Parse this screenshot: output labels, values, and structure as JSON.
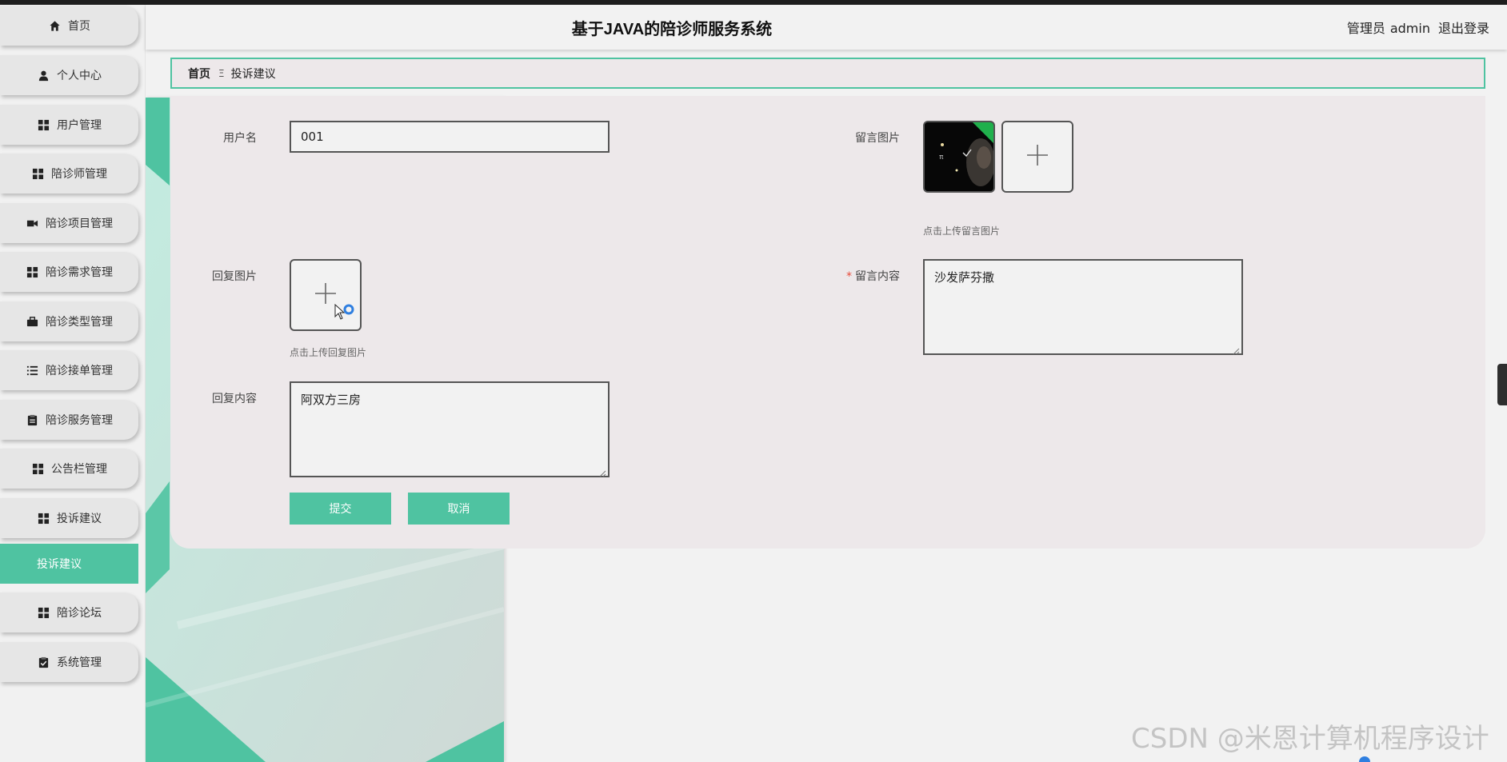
{
  "header": {
    "title": "基于JAVA的陪诊师服务系统",
    "role": "管理员",
    "username": "admin",
    "logout_label": "退出登录"
  },
  "sidebar": {
    "items": [
      {
        "label": "首页",
        "icon": "home-icon"
      },
      {
        "label": "个人中心",
        "icon": "user-icon"
      },
      {
        "label": "用户管理",
        "icon": "grid-icon"
      },
      {
        "label": "陪诊师管理",
        "icon": "grid-icon"
      },
      {
        "label": "陪诊项目管理",
        "icon": "video-icon"
      },
      {
        "label": "陪诊需求管理",
        "icon": "grid-icon"
      },
      {
        "label": "陪诊类型管理",
        "icon": "briefcase-icon"
      },
      {
        "label": "陪诊接单管理",
        "icon": "list-icon"
      },
      {
        "label": "陪诊服务管理",
        "icon": "clipboard-icon"
      },
      {
        "label": "公告栏管理",
        "icon": "grid-icon"
      },
      {
        "label": "投诉建议",
        "icon": "grid-icon"
      },
      {
        "label": "陪诊论坛",
        "icon": "grid-icon"
      },
      {
        "label": "系统管理",
        "icon": "clipboard-check-icon"
      }
    ],
    "active_sub": "投诉建议"
  },
  "breadcrumb": {
    "home": "首页",
    "separator": "Ξ",
    "current": "投诉建议"
  },
  "form": {
    "username_label": "用户名",
    "username_value": "001",
    "message_image_label": "留言图片",
    "message_image_hint": "点击上传留言图片",
    "reply_image_label": "回复图片",
    "reply_image_hint": "点击上传回复图片",
    "message_content_required": "*",
    "message_content_label": "留言内容",
    "message_content_value": "沙发萨芬撒",
    "reply_content_label": "回复内容",
    "reply_content_value": "阿双方三房",
    "submit_label": "提交",
    "cancel_label": "取消"
  },
  "watermark": "CSDN @米恩计算机程序设计",
  "colors": {
    "accent": "#4fc3a1",
    "card_bg": "#ede8ea",
    "page_bg": "#f2f2f2"
  }
}
